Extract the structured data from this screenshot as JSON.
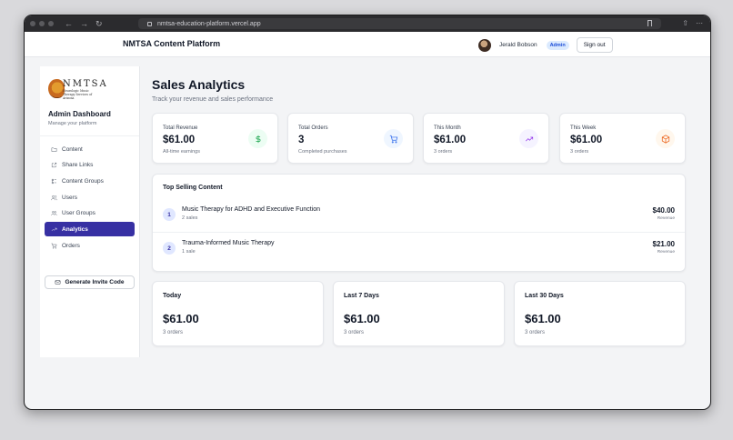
{
  "browser": {
    "url": "nmtsa-education-platform.vercel.app"
  },
  "topnav": {
    "brand": "NMTSA Content Platform",
    "user_name": "Jerald Bobson",
    "role_badge": "Admin",
    "signout_label": "Sign out"
  },
  "sidebar": {
    "logo": {
      "wordmark": "NMTSA",
      "tagline": "Neurologic Music Therapy Services of Arizona"
    },
    "title": "Admin Dashboard",
    "subtitle": "Manage your platform",
    "items": [
      {
        "label": "Content",
        "icon": "folder-icon"
      },
      {
        "label": "Share Links",
        "icon": "external-link-icon"
      },
      {
        "label": "Content Groups",
        "icon": "list-tree-icon"
      },
      {
        "label": "Users",
        "icon": "users-icon"
      },
      {
        "label": "User Groups",
        "icon": "user-group-icon"
      },
      {
        "label": "Analytics",
        "icon": "trending-up-icon",
        "active": true
      },
      {
        "label": "Orders",
        "icon": "cart-icon"
      }
    ],
    "invite_label": "Generate Invite Code"
  },
  "main": {
    "title": "Sales Analytics",
    "subtitle": "Track your revenue and sales performance",
    "stats": [
      {
        "label": "Total Revenue",
        "value": "$61.00",
        "sub": "All-time earnings",
        "icon": "dollar-icon",
        "color": "#16a34a",
        "bg": "#ecfdf3"
      },
      {
        "label": "Total Orders",
        "value": "3",
        "sub": "Completed purchases",
        "icon": "cart-icon",
        "color": "#2563eb",
        "bg": "#eff6ff"
      },
      {
        "label": "This Month",
        "value": "$61.00",
        "sub": "3 orders",
        "icon": "trending-up-icon",
        "color": "#9333ea",
        "bg": "#f5f3ff"
      },
      {
        "label": "This Week",
        "value": "$61.00",
        "sub": "3 orders",
        "icon": "package-icon",
        "color": "#ea580c",
        "bg": "#fff7ed"
      }
    ],
    "top_selling": {
      "title": "Top Selling Content",
      "items": [
        {
          "rank": "1",
          "name": "Music Therapy for ADHD and Executive Function",
          "sales": "2 sales",
          "amount": "$40.00",
          "amount_label": "Revenue"
        },
        {
          "rank": "2",
          "name": "Trauma-Informed Music Therapy",
          "sales": "1 sale",
          "amount": "$21.00",
          "amount_label": "Revenue"
        }
      ]
    },
    "periods": [
      {
        "label": "Today",
        "value": "$61.00",
        "sub": "3 orders"
      },
      {
        "label": "Last 7 Days",
        "value": "$61.00",
        "sub": "3 orders"
      },
      {
        "label": "Last 30 Days",
        "value": "$61.00",
        "sub": "3 orders"
      }
    ]
  }
}
